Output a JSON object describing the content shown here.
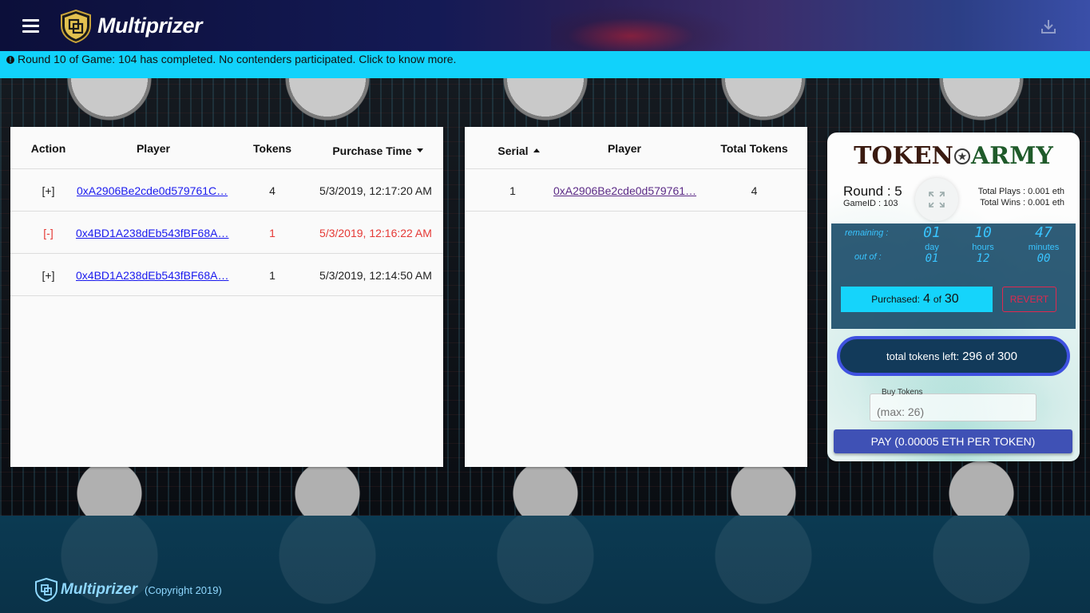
{
  "header": {
    "brand": "Multiprizer",
    "menu_icon": "hamburger-menu-icon",
    "download_icon": "download-icon"
  },
  "notice": {
    "text": "Round 10 of Game: 104 has completed. No contenders participated. Click to know more.",
    "icon": "info-icon"
  },
  "purchases_table": {
    "headers": {
      "action": "Action",
      "player": "Player",
      "tokens": "Tokens",
      "time": "Purchase Time"
    },
    "rows": [
      {
        "action": "[+]",
        "player": "0xA2906Be2cde0d579761C…",
        "tokens": "4",
        "time": "5/3/2019, 12:17:20 AM",
        "highlight": false
      },
      {
        "action": "[-]",
        "player": "0x4BD1A238dEb543fBF68A…",
        "tokens": "1",
        "time": "5/3/2019, 12:16:22 AM",
        "highlight": true
      },
      {
        "action": "[+]",
        "player": "0x4BD1A238dEb543fBF68A…",
        "tokens": "1",
        "time": "5/3/2019, 12:14:50 AM",
        "highlight": false
      }
    ]
  },
  "holders_table": {
    "headers": {
      "serial": "Serial",
      "player": "Player",
      "total": "Total Tokens"
    },
    "rows": [
      {
        "serial": "1",
        "player": "0xA2906Be2cde0d579761…",
        "total": "4"
      }
    ]
  },
  "game_card": {
    "title_left": "TOKEN",
    "title_star": "★",
    "title_right": "ARMY",
    "round": "Round : 5",
    "game_id": "GameID : 103",
    "total_plays": "Total Plays : 0.001 eth",
    "total_wins": "Total Wins : 0.001 eth",
    "timer": {
      "remaining_label": "remaining :",
      "out_of_label": "out of :",
      "day": "01",
      "hours": "10",
      "minutes": "47",
      "day_unit": "day",
      "hours_unit": "hours",
      "minutes_unit": "minutes",
      "day_total": "01",
      "hours_total": "12",
      "minutes_total": "00"
    },
    "purchased_label": "Purchased:",
    "purchased": "4",
    "purchased_of": "of",
    "purchased_max": "30",
    "revert_label": "REVERT",
    "tokens_left_label": "total tokens left:",
    "tokens_left": "296",
    "tokens_left_of": "of",
    "tokens_total": "300",
    "buy_label": "Buy Tokens",
    "buy_placeholder": "(max: 26)",
    "pay_label": "PAY (0.00005 ETH PER TOKEN)"
  },
  "footer": {
    "brand": "Multiprizer",
    "copyright": "(Copyright 2019)"
  },
  "colors": {
    "notice_bar": "#11d2fb",
    "pay_button": "#3f51b5",
    "revert": "#e0284f",
    "timer": "#39c4ff",
    "highlight_row": "#e53935"
  }
}
